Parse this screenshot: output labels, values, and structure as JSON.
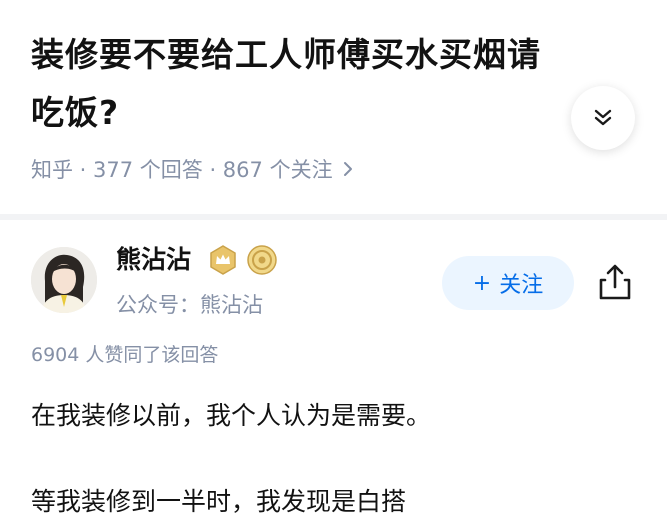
{
  "question": {
    "title": "装修要不要给工人师傅买水买烟请吃饭?",
    "meta": "知乎 · 377 个回答 · 867 个关注"
  },
  "author": {
    "name": "熊沾沾",
    "subtitle": "公众号：熊沾沾",
    "follow_label": "关注",
    "follow_plus": "+"
  },
  "answer": {
    "votes_text": "6904 人赞同了该回答",
    "paragraphs": [
      "在我装修以前，我个人认为是需要。",
      "等我装修到一半时，我发现是白搭"
    ]
  },
  "colors": {
    "accent": "#056de8",
    "follow_bg": "#ebf5ff",
    "meta_text": "#8590a6",
    "badge_gold": "#c9a24a"
  },
  "icons": {
    "expand": "chevron-double-down-icon",
    "meta_arrow": "chevron-right-icon",
    "share": "share-icon",
    "badge1": "crown-badge-icon",
    "badge2": "coin-badge-icon"
  }
}
